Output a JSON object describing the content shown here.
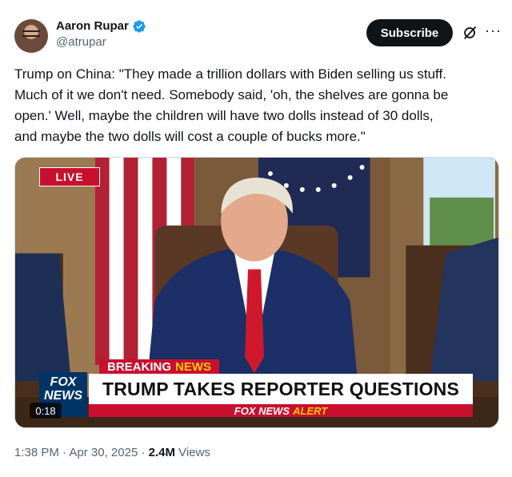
{
  "author": {
    "display_name": "Aaron Rupar",
    "handle": "@atrupar",
    "avatar_icon": "user-avatar"
  },
  "actions": {
    "subscribe_label": "Subscribe",
    "grok_icon": "grok-icon",
    "more_icon": "more-options-icon",
    "more_glyph": "···"
  },
  "tweet": {
    "text": "Trump on China: \"They made a trillion dollars with Biden selling us stuff.\nMuch of it we don't need. Somebody said, 'oh, the shelves are gonna be\nopen.' Well, maybe the children will have two dolls instead of 30 dolls,\nand maybe the two dolls will cost a couple of bucks more.\""
  },
  "video": {
    "live_label": "LIVE",
    "breaking_word1": "BREAKING",
    "breaking_word2": "NEWS",
    "headline": "TRUMP TAKES REPORTER QUESTIONS",
    "alert_prefix": "FOX NEWS",
    "alert_word": "ALERT",
    "logo_line1": "FOX",
    "logo_line2": "NEWS",
    "elapsed": "0:18"
  },
  "meta": {
    "time": "1:38 PM",
    "sep1": " · ",
    "date": "Apr 30, 2025",
    "sep2": " · ",
    "views_count": "2.4M",
    "views_label": " Views"
  },
  "colors": {
    "accent": "#1d9bf0",
    "fox_red": "#c8102e",
    "fox_blue": "#003366",
    "alert_yellow": "#ffcc00"
  }
}
